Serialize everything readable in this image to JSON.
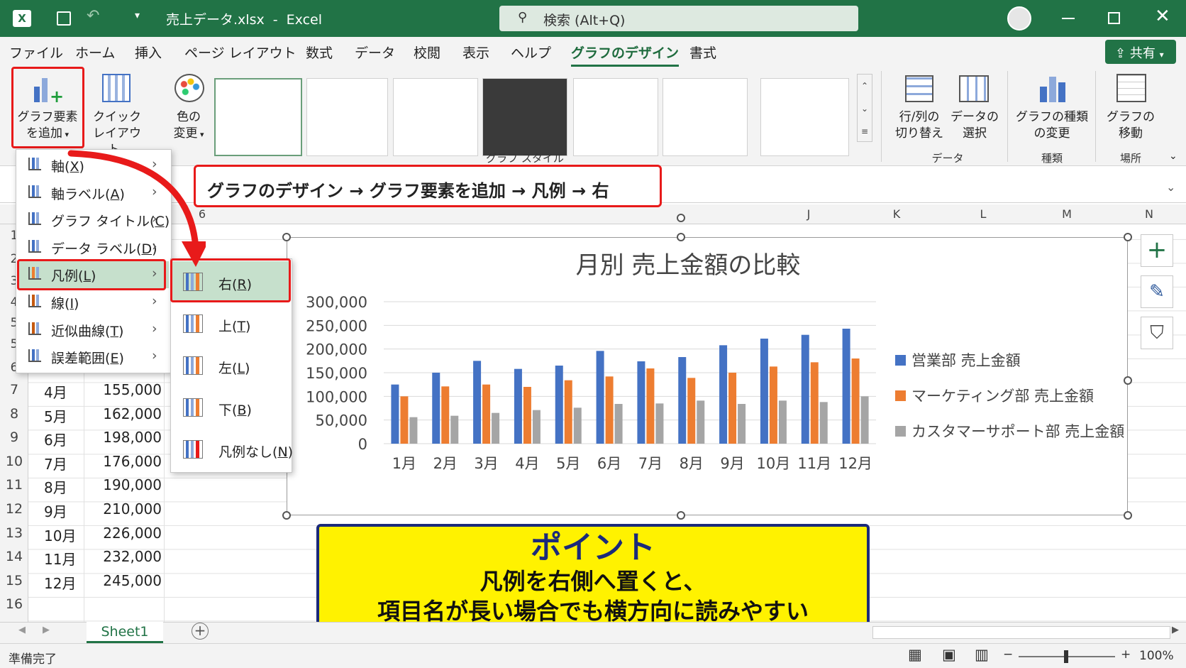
{
  "title_bar": {
    "filename": "売上データ.xlsx",
    "separator": "-",
    "app": "Excel",
    "search": "検索 (Alt+Q)"
  },
  "tabs": [
    "ファイル",
    "ホーム",
    "挿入",
    "ページ レイアウト",
    "数式",
    "データ",
    "校閲",
    "表示",
    "ヘルプ",
    "グラフのデザイン",
    "書式"
  ],
  "share_button": "共有",
  "ribbon": {
    "add_element": [
      "グラフ要素",
      "を追加"
    ],
    "quick_layout": [
      "クイック",
      "レイアウト"
    ],
    "change_colors": [
      "色の",
      "変更"
    ],
    "styles_group": "グラフ スタイル",
    "switch_rowcol": [
      "行/列の",
      "切り替え"
    ],
    "select_data": [
      "データの",
      "選択"
    ],
    "data_group": "データ",
    "change_type": [
      "グラフの種類",
      "の変更"
    ],
    "type_group": "種類",
    "move_chart": [
      "グラフの",
      "移動"
    ],
    "location_group": "場所"
  },
  "add_element_menu": [
    {
      "label": "軸",
      "key": "X"
    },
    {
      "label": "軸ラベル",
      "key": "A"
    },
    {
      "label": "グラフ タイトル",
      "key": "C"
    },
    {
      "label": "データ ラベル",
      "key": "D"
    },
    {
      "label": "凡例",
      "key": "L"
    },
    {
      "label": "線",
      "key": "I"
    },
    {
      "label": "近似曲線",
      "key": "T"
    },
    {
      "label": "誤差範囲",
      "key": "E"
    }
  ],
  "legend_submenu": [
    {
      "label": "右",
      "key": "R"
    },
    {
      "label": "上",
      "key": "T"
    },
    {
      "label": "左",
      "key": "L"
    },
    {
      "label": "下",
      "key": "B"
    },
    {
      "label": "凡例なし",
      "key": "N"
    }
  ],
  "instruction": "グラフのデザイン → グラフ要素を追加 → 凡例 → 右",
  "columns": [
    "6",
    "J",
    "K",
    "L",
    "M",
    "N"
  ],
  "rows": [
    {
      "n": "7",
      "month": "4月",
      "value": "155,000"
    },
    {
      "n": "8",
      "month": "5月",
      "value": "162,000"
    },
    {
      "n": "9",
      "month": "6月",
      "value": "198,000"
    },
    {
      "n": "10",
      "month": "7月",
      "value": "176,000"
    },
    {
      "n": "11",
      "month": "8月",
      "value": "190,000"
    },
    {
      "n": "12",
      "month": "9月",
      "value": "210,000"
    },
    {
      "n": "13",
      "month": "10月",
      "value": "226,000"
    },
    {
      "n": "14",
      "month": "11月",
      "value": "232,000"
    },
    {
      "n": "15",
      "month": "12月",
      "value": "245,000"
    },
    {
      "n": "16",
      "month": "",
      "value": ""
    }
  ],
  "hidden_row_nums": [
    "1",
    "2",
    "3",
    "4",
    "5",
    "5",
    "6"
  ],
  "chart_data": {
    "type": "bar",
    "title": "月別 売上金額の比較",
    "categories": [
      "1月",
      "2月",
      "3月",
      "4月",
      "5月",
      "6月",
      "7月",
      "8月",
      "9月",
      "10月",
      "11月",
      "12月"
    ],
    "y_ticks": [
      "300,000",
      "250,000",
      "200,000",
      "150,000",
      "100,000",
      "50,000",
      "0"
    ],
    "ylim": [
      0,
      300000
    ],
    "legend_position": "right",
    "series": [
      {
        "name": "営業部 売上金額",
        "color": "#4472c4",
        "values": [
          125000,
          150000,
          175000,
          158000,
          165000,
          196000,
          174000,
          183000,
          208000,
          222000,
          230000,
          243000
        ]
      },
      {
        "name": "マーケティング部 売上金額",
        "color": "#ed7d31",
        "values": [
          100000,
          121000,
          125000,
          120000,
          134000,
          142000,
          159000,
          139000,
          150000,
          163000,
          172000,
          180000
        ]
      },
      {
        "name": "カスタマーサポート部 売上金額",
        "color": "#a5a5a5",
        "values": [
          56000,
          59000,
          65000,
          71000,
          76000,
          84000,
          85000,
          91000,
          84000,
          91000,
          88000,
          100000
        ]
      }
    ]
  },
  "point": {
    "heading": "ポイント",
    "line1": "凡例を右側へ置くと、",
    "line2": "項目名が長い場合でも横方向に読みやすい"
  },
  "sheet_tab": "Sheet1",
  "status": {
    "ready": "準備完了",
    "zoom": "100%"
  }
}
